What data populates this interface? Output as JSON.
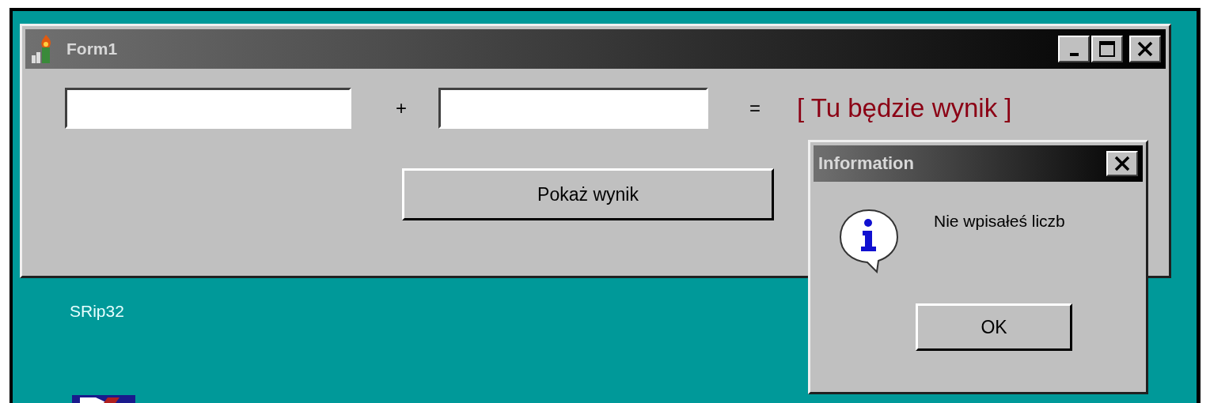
{
  "main_window": {
    "title": "Form1",
    "plus_sign": "+",
    "equals_sign": "=",
    "result_label": "[ Tu będzie wynik ]",
    "button": "Pokaż wynik"
  },
  "dialog": {
    "title": "Information",
    "message": "Nie wpisałeś liczb",
    "button": "OK"
  },
  "desktop": {
    "labels": [
      "SRip32"
    ]
  }
}
